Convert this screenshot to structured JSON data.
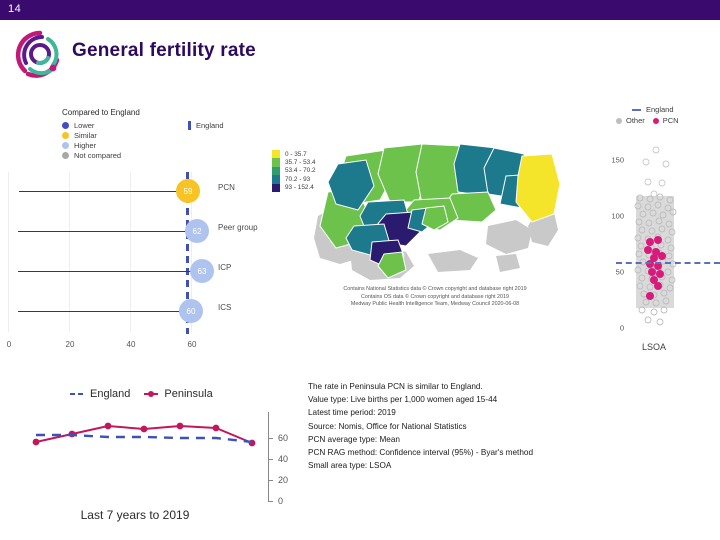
{
  "header": {
    "slide_number": "14",
    "title": "General fertility rate",
    "bar_color": "#3b0a6e",
    "title_color": "#2e0a5e"
  },
  "logo": {
    "name": "medway-public-health-logo",
    "colors": [
      "#c2187a",
      "#5b1a8b",
      "#3fb79b"
    ]
  },
  "compare_legend": {
    "header": "Compared to England",
    "items": [
      {
        "label": "Lower",
        "color": "#4050c0"
      },
      {
        "label": "Similar",
        "color": "#f7c325"
      },
      {
        "label": "Higher",
        "color": "#aec4ef"
      },
      {
        "label": "Not compared",
        "color": "#a8a8a8"
      }
    ],
    "england_key": {
      "label": "England",
      "color": "#3f51b5"
    }
  },
  "bar_chart": {
    "type": "bar",
    "title": "",
    "xlabel": "",
    "ylabel": "",
    "xlim": [
      0,
      70
    ],
    "xticks": [
      "0",
      "20",
      "40",
      "60"
    ],
    "england_reference": 59,
    "categories": [
      "PCN",
      "Peer group",
      "ICP",
      "ICS"
    ],
    "values": [
      59,
      62,
      63,
      60
    ],
    "value_labels": [
      "59",
      "62",
      "63",
      "60"
    ],
    "point_colors": [
      "#f7c325",
      "#aec4ef",
      "#aec4ef",
      "#aec4ef"
    ],
    "comparisons": [
      "Similar",
      "Higher",
      "Higher",
      "Higher"
    ]
  },
  "map": {
    "legend_title": "",
    "bins": [
      {
        "range": "0 - 35.7",
        "color": "#f5e52a"
      },
      {
        "range": "35.7 - 53.4",
        "color": "#6cc24a"
      },
      {
        "range": "53.4 - 70.2",
        "color": "#2f9e6e"
      },
      {
        "range": "70.2 - 93",
        "color": "#1c7a8c"
      },
      {
        "range": "93 - 152.4",
        "color": "#2b1b6e"
      }
    ],
    "attribution": [
      "Contains National Statistics data © Crown copyright and database right 2019",
      "Contains OS data © Crown copyright and database right 2019",
      "Medway Public Health Intelligence Team, Medway Council 2020-06-08"
    ]
  },
  "scatter": {
    "type": "scatter",
    "legend": [
      {
        "label": "England",
        "color": "#5a6fbe",
        "marker": "dashed-line"
      },
      {
        "label": "Other",
        "color": "#bdbdbd",
        "marker": "circle"
      },
      {
        "label": "PCN",
        "color": "#d81b7a",
        "marker": "circle"
      }
    ],
    "yticks": [
      "150",
      "100",
      "50",
      "0"
    ],
    "ylim": [
      0,
      160
    ],
    "england_value": 59,
    "xlabel": "LSOA"
  },
  "trend": {
    "type": "line",
    "legend": [
      {
        "label": "England",
        "color": "#3f51b5",
        "style": "dashed"
      },
      {
        "label": "Peninsula",
        "color": "#c2185b",
        "style": "solid"
      }
    ],
    "xlabel": "Last 7 years to 2019",
    "yticks": [
      "60",
      "40",
      "20",
      "0"
    ],
    "ylim": [
      0,
      70
    ],
    "categories": [
      "1",
      "2",
      "3",
      "4",
      "5",
      "6",
      "7"
    ],
    "series": [
      {
        "name": "England",
        "values": [
          62,
          62,
          61,
          61,
          60,
          60,
          58
        ]
      },
      {
        "name": "Peninsula",
        "values": [
          58,
          62,
          66,
          65,
          66,
          65,
          58
        ]
      }
    ]
  },
  "info": {
    "lines": [
      "The rate in Peninsula PCN is similar to England.",
      "Value type: Live births per 1,000 women aged 15-44",
      "Latest time period: 2019",
      "Source: Nomis, Office for National Statistics",
      "PCN average type: Mean",
      "PCN RAG method: Confidence interval (95%) - Byar's method",
      "Small area type: LSOA"
    ]
  }
}
